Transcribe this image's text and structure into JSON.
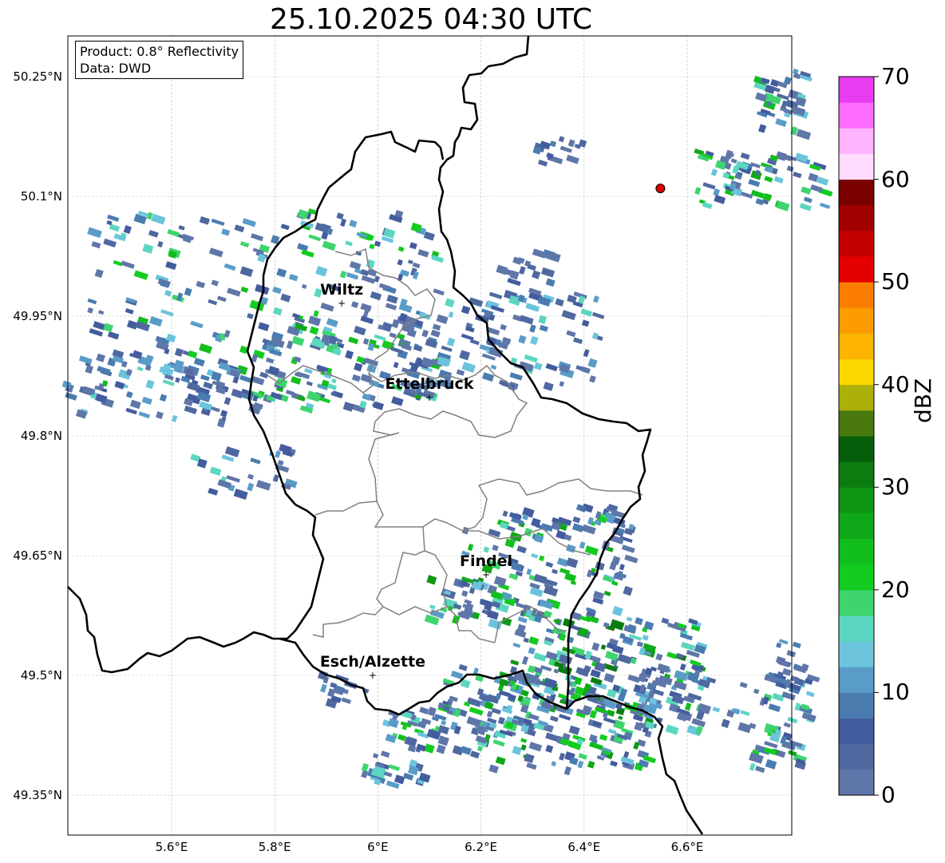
{
  "title": "25.10.2025 04:30 UTC",
  "info": {
    "product_line": "Product: 0.8° Reflectivity",
    "data_line": "Data: DWD"
  },
  "map": {
    "lon_range": [
      5.4,
      6.8
    ],
    "lat_range": [
      49.3,
      50.3
    ],
    "lat_ticks": [
      "50.25°N",
      "50.1°N",
      "49.95°N",
      "49.8°N",
      "49.65°N",
      "49.5°N",
      "49.35°N"
    ],
    "lon_ticks": [
      "5.6°E",
      "5.8°E",
      "6°E",
      "6.2°E",
      "6.4°E",
      "6.6°E"
    ],
    "gridlines": true,
    "cities": [
      {
        "name": "Wiltz",
        "lon": 5.93,
        "lat": 49.966
      },
      {
        "name": "Ettelbruck",
        "lon": 6.1,
        "lat": 49.848
      },
      {
        "name": "Findel",
        "lon": 6.21,
        "lat": 49.626
      },
      {
        "name": "Esch/Alzette",
        "lon": 5.99,
        "lat": 49.5
      }
    ],
    "radar_site": {
      "lon": 6.548,
      "lat": 50.11,
      "color": "#e00000"
    }
  },
  "colorbar": {
    "label": "dBZ",
    "tick_labels": [
      "0",
      "10",
      "20",
      "30",
      "40",
      "50",
      "60",
      "70"
    ],
    "range": [
      0,
      70
    ],
    "colors": [
      "#5f76a8",
      "#4f68a0",
      "#435c9e",
      "#4a7cb0",
      "#5a9cc8",
      "#6bc4dc",
      "#5cd6c0",
      "#3ed46e",
      "#14cc20",
      "#12be1c",
      "#10a818",
      "#0f9614",
      "#0c7c10",
      "#075e0a",
      "#4a7a0e",
      "#acb00a",
      "#fcd800",
      "#fcb400",
      "#fc9c00",
      "#fc7e00",
      "#e40000",
      "#c40000",
      "#a00000",
      "#7a0000",
      "#ffdcff",
      "#ffb4ff",
      "#ff6cff",
      "#e83cf0"
    ]
  },
  "echoes_note": "",
  "colors": {
    "border_country": "#000000",
    "border_canton": "#808080",
    "grid": "#bbbbbb"
  }
}
